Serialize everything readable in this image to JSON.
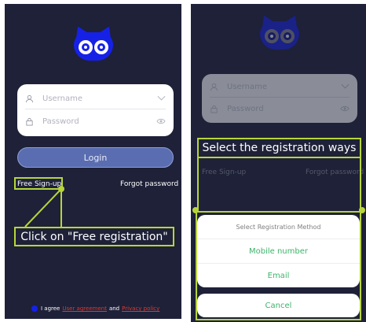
{
  "left_screen": {
    "username_placeholder": "Username",
    "password_placeholder": "Password",
    "login_label": "Login",
    "free_signup_label": "Free Sign-up",
    "forgot_password_label": "Forgot password",
    "callout_text": "Click on \"Free registration\"",
    "agreement": {
      "prefix": "I agree",
      "user_agreement": "User agreement",
      "and": "and",
      "privacy_policy": "Privacy policy"
    }
  },
  "right_screen": {
    "username_placeholder": "Username",
    "password_placeholder": "Password",
    "free_signup_label": "Free Sign-up",
    "forgot_password_label": "Forgot password",
    "callout_text": "Select the registration ways",
    "sheet": {
      "title": "Select Registration Method",
      "options": [
        "Mobile number",
        "Email"
      ],
      "cancel_label": "Cancel"
    }
  },
  "colors": {
    "background": "#1e2138",
    "brand_blue": "#1621e8",
    "annotation": "#b7d53a",
    "option_green": "#3db36a",
    "link_red": "#e0362c"
  },
  "icons": [
    "owl-logo",
    "user-icon",
    "lock-icon",
    "chevron-down-icon",
    "eye-icon"
  ]
}
